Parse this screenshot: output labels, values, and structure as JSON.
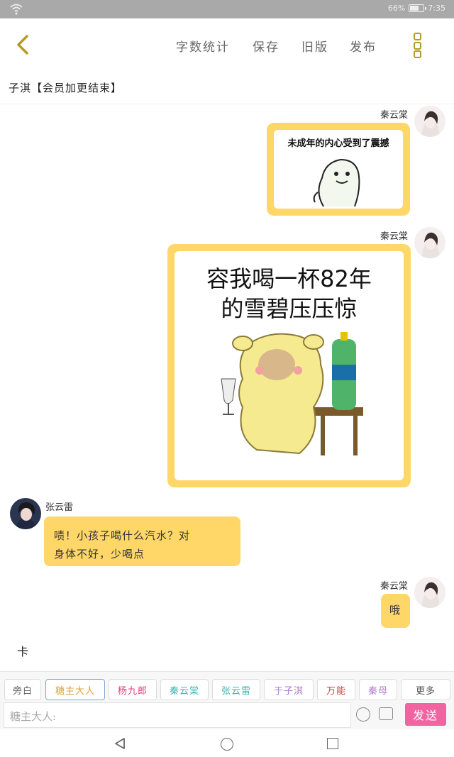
{
  "status": {
    "battery": "66%",
    "time": "7:35"
  },
  "toolbar": {
    "word_count": "字数统计",
    "save": "保存",
    "old_version": "旧版",
    "publish": "发布"
  },
  "doc_title": "子淇【会员加更结束】",
  "messages": [
    {
      "sender": "秦云棠",
      "side": "right",
      "type": "image",
      "caption": "未成年的内心受到了震撼"
    },
    {
      "sender": "秦云棠",
      "side": "right",
      "type": "image",
      "caption_line1": "容我喝一杯82年",
      "caption_line2": "的雪碧压压惊"
    },
    {
      "sender": "张云雷",
      "side": "left",
      "type": "text",
      "text_line1": "啧！小孩子喝什么汽水？对",
      "text_line2": "身体不好，少喝点"
    },
    {
      "sender": "秦云棠",
      "side": "right",
      "type": "text",
      "text": "哦"
    }
  ],
  "draft_text": "卡",
  "roles": [
    {
      "label": "旁白",
      "color": "#666666"
    },
    {
      "label": "糖主大人",
      "color": "#e2a23a"
    },
    {
      "label": "杨九郎",
      "color": "#e0407a"
    },
    {
      "label": "秦云棠",
      "color": "#3bb3b0"
    },
    {
      "label": "张云雷",
      "color": "#3bb3b0"
    },
    {
      "label": "于子淇",
      "color": "#b07ad0"
    },
    {
      "label": "万能",
      "color": "#d04040"
    },
    {
      "label": "秦母",
      "color": "#b07ad0"
    },
    {
      "label": "更多",
      "color": "#555555"
    }
  ],
  "input": {
    "placeholder": "糖主大人:"
  },
  "send_label": "发送",
  "colors": {
    "bubble": "#ffd768",
    "send": "#f263a1",
    "accent": "#b79b1f"
  }
}
